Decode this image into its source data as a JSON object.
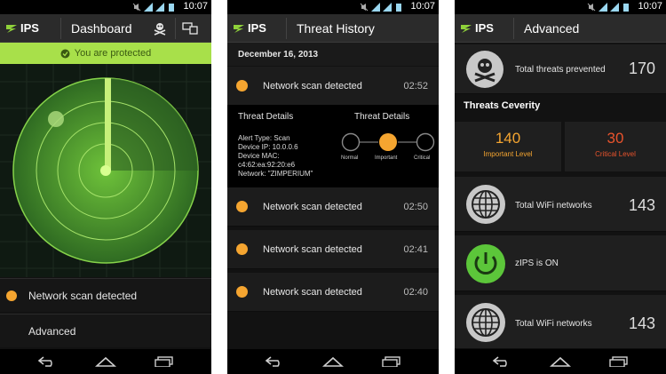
{
  "status": {
    "time": "10:07"
  },
  "colors": {
    "accent_green": "#a8e04a",
    "orange": "#f5a530",
    "red": "#e8532c"
  },
  "phone1": {
    "app_name": "IPS",
    "title": "Dashboard",
    "protected_text": "You are protected",
    "alert_item": "Network scan detected",
    "advanced_item": "Advanced"
  },
  "phone2": {
    "app_name": "IPS",
    "title": "Threat History",
    "date": "December 16, 2013",
    "rows": [
      {
        "label": "Network scan detected",
        "time": "02:52"
      },
      {
        "label": "Network scan detected",
        "time": "02:50"
      },
      {
        "label": "Network scan detected",
        "time": "02:41"
      },
      {
        "label": "Network scan detected",
        "time": "02:40"
      }
    ],
    "details": {
      "heading_left": "Threat Details",
      "heading_right": "Threat Details",
      "lines": [
        "Alert Type: Scan",
        "Device IP: 10.0.0.6",
        "Device MAC:",
        "c4:62:ea:92:20:e6",
        "Network: \"ZIMPERIUM\""
      ],
      "severity_labels": [
        "Normal",
        "Important",
        "Critical"
      ],
      "selected_severity": "Important"
    }
  },
  "phone3": {
    "app_name": "IPS",
    "title": "Advanced",
    "threats_prevented_label": "Total threats prevented",
    "threats_prevented_value": "170",
    "severity_title": "Threats Ceverity",
    "important_value": "140",
    "important_label": "Important Level",
    "critical_value": "30",
    "critical_label": "Critical Level",
    "wifi1_label": "Total WiFi networks",
    "wifi1_value": "143",
    "zips_label": "zIPS is ON",
    "wifi2_label": "Total WiFi networks",
    "wifi2_value": "143"
  }
}
